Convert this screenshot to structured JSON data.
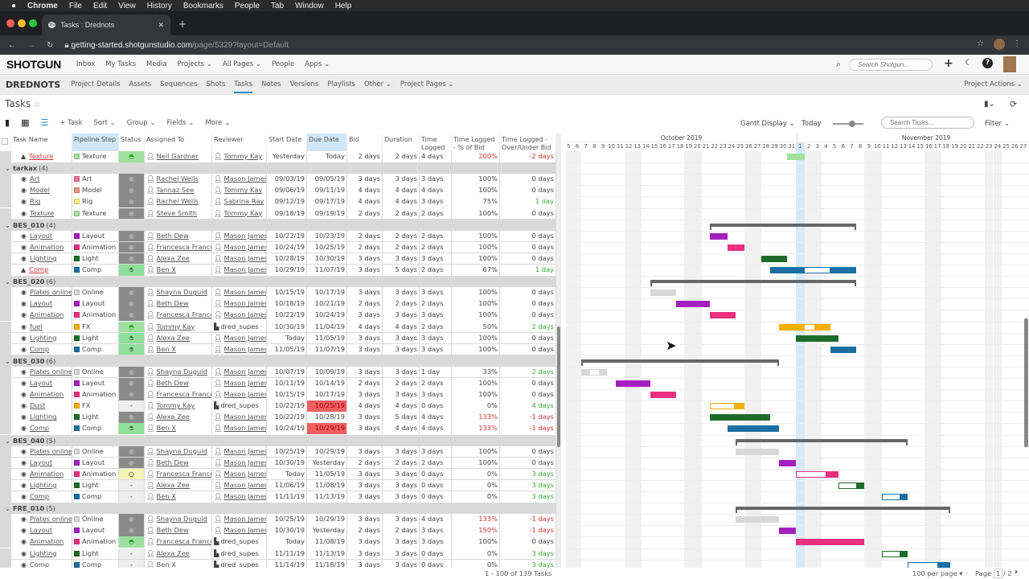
{
  "mac": {
    "menus": [
      "Chrome",
      "File",
      "Edit",
      "View",
      "History",
      "Bookmarks",
      "People",
      "Tab",
      "Window",
      "Help"
    ]
  },
  "browser": {
    "tab_title": "Tasks : Drednots",
    "favicon": "SG",
    "url_host": "getting-started.shotgunstudio.com",
    "url_path": "/page/5329?layout=Default"
  },
  "topnav": {
    "logo": "SHOTGUN",
    "items": [
      "Inbox",
      "My Tasks",
      "Media",
      "Projects ⌄",
      "All Pages ⌄",
      "People",
      "Apps ⌄"
    ],
    "search_placeholder": "Search Shotgun..."
  },
  "projnav": {
    "project": "DREDNOTS",
    "items": [
      "Project Details",
      "Assets",
      "Sequences",
      "Shots",
      "Tasks",
      "Notes",
      "Versions",
      "Playlists",
      "Other ⌄",
      "Project Pages ⌄"
    ],
    "active": "Tasks",
    "actions": "Project Actions ⌄"
  },
  "page": {
    "title": "Tasks",
    "star": "☆"
  },
  "toolbar": {
    "add_task": "+ Task",
    "sort": "Sort ⌄",
    "group": "Group ⌄",
    "fields": "Fields ⌄",
    "more": "More ⌄",
    "gantt_display": "Gantt Display ⌄",
    "today": "Today",
    "search_placeholder": "Search Tasks...",
    "filter": "Filter ⌄"
  },
  "columns": [
    "Task Name",
    "Pipeline Step",
    "Status",
    "Assigned To",
    "Reviewer",
    "Start Date",
    "Due Date",
    "Bid",
    "Duration",
    "Time Logged",
    "Time Logged - % of Bid",
    "Time Logged - Over/Under Bid"
  ],
  "gantt": {
    "months": [
      "October 2019",
      "November 2019"
    ],
    "today": "11/01/19",
    "yesterday": "10/31/19"
  },
  "step_colors": {
    "Texture": "#9fe09a",
    "Art": "#e8739a",
    "Model": "#ee8f80",
    "Rig": "#f2f08a",
    "Layout": "#a41fbf",
    "Animation": "#e8307f",
    "Light": "#1f6b2a",
    "Comp": "#1b6fa3",
    "Online": "#d8d8d8",
    "FX": "#f2b000"
  },
  "groups": [
    {
      "name": "",
      "tasks": [
        [
          "Texture",
          "warn",
          "Texture",
          "ip",
          "Neil Gardner",
          "p",
          "Tommy Kay",
          "p",
          "Yesterday",
          "Today",
          "2 days",
          "2 days",
          "4 days",
          "200%",
          "-2 days"
        ]
      ]
    },
    {
      "name": "tarkax",
      "count": "(4)",
      "tasks": [
        [
          "Art",
          "ok",
          "Art",
          "fin",
          "Rachel Wells",
          "p",
          "Mason James",
          "p",
          "09/03/19",
          "09/05/19",
          "3 days",
          "3 days",
          "3 days",
          "100%",
          "0 days"
        ],
        [
          "Model",
          "ok",
          "Model",
          "fin",
          "Tannaz See",
          "p",
          "Tommy Kay",
          "p",
          "09/06/19",
          "09/11/19",
          "4 days",
          "4 days",
          "4 days",
          "100%",
          "0 days"
        ],
        [
          "Rig",
          "ok",
          "Rig",
          "fin",
          "Rachel Wells",
          "p",
          "Sabrina Ray",
          "p",
          "09/12/19",
          "09/17/19",
          "4 days",
          "4 days",
          "3 days",
          "75%",
          "1 day"
        ],
        [
          "Texture",
          "ok",
          "Texture",
          "fin",
          "Steve Smith",
          "p",
          "Tommy Kay",
          "p",
          "09/18/19",
          "09/19/19",
          "2 days",
          "2 days",
          "2 days",
          "100%",
          "0 days"
        ]
      ]
    },
    {
      "name": "BES_010",
      "count": "(4)",
      "tasks": [
        [
          "Layout",
          "ok",
          "Layout",
          "fin",
          "Beth Dew",
          "p",
          "Mason James",
          "p",
          "10/22/19",
          "10/23/19",
          "2 days",
          "2 days",
          "2 days",
          "100%",
          "0 days"
        ],
        [
          "Animation",
          "ok",
          "Animation",
          "fin",
          "Francesca Franco",
          "p",
          "Mason James",
          "p",
          "10/24/19",
          "10/25/19",
          "2 days",
          "2 days",
          "2 days",
          "100%",
          "0 days"
        ],
        [
          "Lighting",
          "ok",
          "Light",
          "fin",
          "Alexa Zee",
          "p",
          "Mason James",
          "p",
          "10/28/19",
          "10/30/19",
          "3 days",
          "3 days",
          "3 days",
          "100%",
          "0 days"
        ],
        [
          "Comp",
          "warn",
          "Comp",
          "hand",
          "Ben X",
          "p",
          "Mason James",
          "p",
          "10/29/19",
          "11/07/19",
          "3 days",
          "5 days",
          "2 days",
          "67%",
          "1 day"
        ]
      ]
    },
    {
      "name": "BES_020",
      "count": "(6)",
      "tasks": [
        [
          "Plates online",
          "ok",
          "Online",
          "fin",
          "Shayna Duguid",
          "p",
          "Mason James",
          "p",
          "10/15/19",
          "10/17/19",
          "3 days",
          "3 days",
          "3 days",
          "100%",
          "0 days"
        ],
        [
          "Layout",
          "ok",
          "Layout",
          "fin",
          "Beth Dew",
          "p",
          "Mason James",
          "p",
          "10/18/19",
          "10/21/19",
          "2 days",
          "2 days",
          "2 days",
          "100%",
          "0 days"
        ],
        [
          "Animation",
          "ok",
          "Animation",
          "fin",
          "Francesca Franco",
          "p",
          "Mason James",
          "p",
          "10/22/19",
          "10/24/19",
          "3 days",
          "3 days",
          "3 days",
          "100%",
          "0 days"
        ],
        [
          "fuel",
          "ok",
          "FX",
          "ip",
          "Tommy Kay",
          "p",
          "dred_supes",
          "g",
          "10/30/19",
          "11/04/19",
          "4 days",
          "4 days",
          "2 days",
          "50%",
          "2 days"
        ],
        [
          "Lighting",
          "ok",
          "Light",
          "hand",
          "Alexa Zee",
          "p",
          "Mason James",
          "p",
          "Today",
          "11/05/19",
          "3 days",
          "3 days",
          "3 days",
          "100%",
          "0 days"
        ],
        [
          "Comp",
          "ok",
          "Comp",
          "hand",
          "Ben X",
          "p",
          "Mason James",
          "p",
          "11/05/19",
          "11/07/19",
          "3 days",
          "3 days",
          "3 days",
          "100%",
          "0 days"
        ]
      ]
    },
    {
      "name": "BES_030",
      "count": "(6)",
      "tasks": [
        [
          "Plates online",
          "ok",
          "Online",
          "fin",
          "Shayna Duguid",
          "p",
          "Mason James",
          "p",
          "10/07/19",
          "10/09/19",
          "3 days",
          "3 days",
          "1 day",
          "33%",
          "2 days"
        ],
        [
          "Layout",
          "ok",
          "Layout",
          "fin",
          "Beth Dew",
          "p",
          "Mason James",
          "p",
          "10/11/19",
          "10/14/19",
          "2 days",
          "2 days",
          "2 days",
          "100%",
          "0 days"
        ],
        [
          "Animation",
          "ok",
          "Animation",
          "fin",
          "Francesca Franco",
          "p",
          "Mason James",
          "p",
          "10/15/19",
          "10/17/19",
          "3 days",
          "3 days",
          "3 days",
          "100%",
          "0 days"
        ],
        [
          "Dust",
          "ok",
          "FX",
          "wtg",
          "Tommy Kay",
          "p",
          "dred_supes",
          "g",
          "10/22/19",
          "10/25/19",
          "4 days",
          "4 days",
          "0 days",
          "0%",
          "4 days",
          "late"
        ],
        [
          "Lighting",
          "ok",
          "Light",
          "fin",
          "Alexa Zee",
          "p",
          "Mason James",
          "p",
          "10/22/19",
          "10/28/19",
          "3 days",
          "5 days",
          "4 days",
          "133%",
          "-1 days"
        ],
        [
          "Comp",
          "ok",
          "Comp",
          "hand",
          "Ben X",
          "p",
          "Mason James",
          "p",
          "10/24/19",
          "10/29/19",
          "3 days",
          "4 days",
          "4 days",
          "133%",
          "-1 days",
          "late"
        ]
      ]
    },
    {
      "name": "BES_040",
      "count": "(5)",
      "tasks": [
        [
          "Plates online",
          "ok",
          "Online",
          "fin",
          "Shayna Duguid",
          "p",
          "Mason James",
          "p",
          "10/25/19",
          "10/29/19",
          "3 days",
          "3 days",
          "3 days",
          "100%",
          "0 days"
        ],
        [
          "Layout",
          "ok",
          "Layout",
          "fin",
          "Beth Dew",
          "p",
          "Mason James",
          "p",
          "10/30/19",
          "Yesterday",
          "2 days",
          "2 days",
          "2 days",
          "100%",
          "0 days"
        ],
        [
          "Animation",
          "ok",
          "Animation",
          "rdy",
          "Francesca Franco",
          "p",
          "Mason James",
          "p",
          "Today",
          "11/05/19",
          "3 days",
          "3 days",
          "0 days",
          "0%",
          "3 days"
        ],
        [
          "Lighting",
          "ok",
          "Light",
          "wtg",
          "Alexa Zee",
          "p",
          "Mason James",
          "p",
          "11/06/19",
          "11/08/19",
          "3 days",
          "3 days",
          "0 days",
          "0%",
          "3 days"
        ],
        [
          "Comp",
          "ok",
          "Comp",
          "wtg",
          "Ben X",
          "p",
          "Mason James",
          "p",
          "11/11/19",
          "11/13/19",
          "3 days",
          "3 days",
          "0 days",
          "0%",
          "3 days"
        ]
      ]
    },
    {
      "name": "FRE_010",
      "count": "(5)",
      "tasks": [
        [
          "Plates online",
          "ok",
          "Online",
          "fin",
          "Shayna Duguid",
          "p",
          "Mason James",
          "p",
          "10/25/19",
          "10/29/19",
          "3 days",
          "3 days",
          "4 days",
          "133%",
          "-1 days"
        ],
        [
          "Layout",
          "ok",
          "Layout",
          "fin",
          "Beth Dew",
          "p",
          "Mason James",
          "p",
          "10/30/19",
          "Yesterday",
          "2 days",
          "2 days",
          "3 days",
          "150%",
          "-1 days"
        ],
        [
          "Animation",
          "ok",
          "Animation",
          "ip",
          "Francesca Franco",
          "p",
          "dred_supes",
          "g",
          "Today",
          "11/08/19",
          "3 days",
          "3 days",
          "3 days",
          "100%",
          "0 days"
        ],
        [
          "Lighting",
          "ok",
          "Light",
          "wtg",
          "Alexa Zee",
          "p",
          "dred_supes",
          "g",
          "11/11/19",
          "11/13/19",
          "3 days",
          "3 days",
          "0 days",
          "0%",
          "3 days"
        ],
        [
          "Comp",
          "ok",
          "Comp",
          "wtg",
          "Ben X",
          "p",
          "dred_supes",
          "g",
          "11/14/19",
          "11/18/19",
          "3 days",
          "3 days",
          "0 days",
          "0%",
          "3 days"
        ]
      ]
    }
  ],
  "footer": {
    "count": "1 - 100 of 139 Tasks",
    "per_page": "100 per page ▾",
    "page_label": "Page",
    "page": "1",
    "total": "/ 2"
  }
}
